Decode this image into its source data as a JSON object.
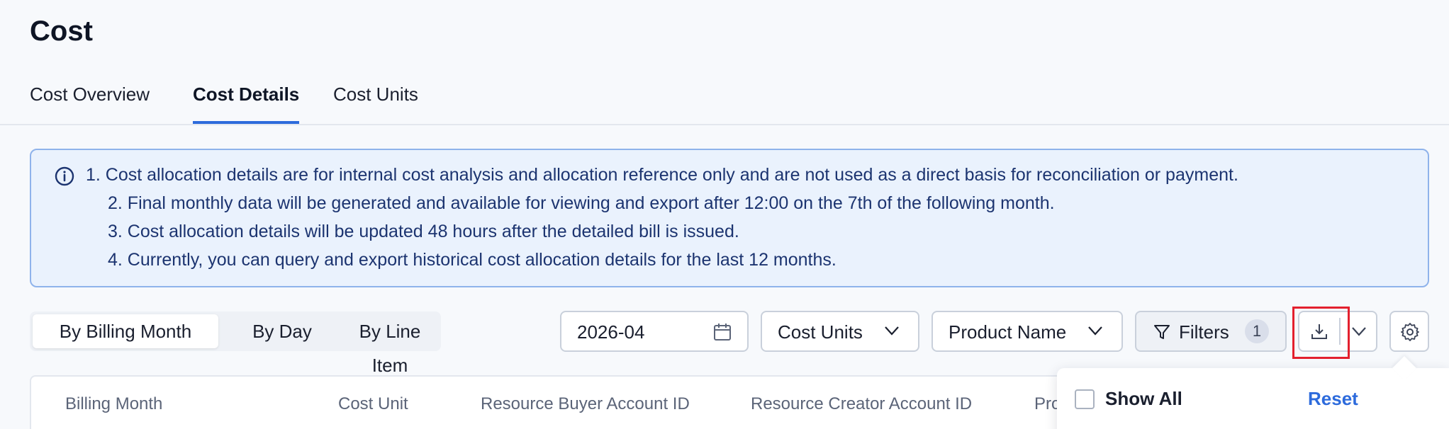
{
  "page": {
    "title": "Cost"
  },
  "tabs": [
    {
      "label": "Cost Overview"
    },
    {
      "label": "Cost Details"
    },
    {
      "label": "Cost Units"
    }
  ],
  "notice": {
    "icon": "info-circle-icon",
    "lines": [
      "1. Cost allocation details are for internal cost analysis and allocation reference only and are not used as a direct basis for reconciliation or payment.",
      "2. Final monthly data will be generated and available for viewing and export after 12:00 on the 7th of the following month.",
      "3. Cost allocation details will be updated 48 hours after the detailed bill is issued.",
      "4. Currently, you can query and export historical cost allocation details for the last 12 months."
    ]
  },
  "view_toggle": {
    "options": [
      "By Billing Month",
      "By Day",
      "By Line Item"
    ],
    "selected": "By Billing Month"
  },
  "toolbar": {
    "date_value": "2026-04",
    "cost_units_label": "Cost Units",
    "product_name_label": "Product Name",
    "filters_label": "Filters",
    "filters_count": "1"
  },
  "table": {
    "columns": [
      "Billing Month",
      "Cost Unit",
      "Resource Buyer Account ID",
      "Resource Creator Account ID",
      "Pro"
    ]
  },
  "popover": {
    "show_all_label": "Show All",
    "reset_label": "Reset"
  },
  "colors": {
    "accent": "#2d6bdc",
    "notice_bg": "#eaf2fd",
    "notice_border": "#8fb3eb",
    "highlight": "#e3202e"
  }
}
